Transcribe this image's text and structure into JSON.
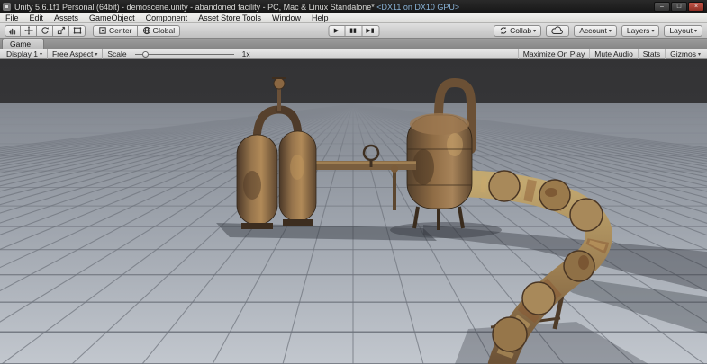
{
  "window": {
    "title_main": "Unity 5.6.1f1 Personal (64bit) - demoscene.unity - abandoned facility - PC, Mac & Linux Standalone*",
    "title_gpu": "<DX11 on DX10 GPU>",
    "minimize": "–",
    "maximize": "□",
    "close": "×"
  },
  "menu_bar": {
    "items": [
      "File",
      "Edit",
      "Assets",
      "GameObject",
      "Component",
      "Asset Store Tools",
      "Window",
      "Help"
    ]
  },
  "toolbar": {
    "pivot_label": "Center",
    "space_label": "Global",
    "play_icon": "▶",
    "pause_icon": "▮▮",
    "step_icon": "▶▮",
    "collab_label": "Collab",
    "account_label": "Account",
    "layers_label": "Layers",
    "layout_label": "Layout",
    "dropdown_arrow": "▾"
  },
  "game_panel": {
    "tab_label": "Game",
    "display_dropdown": "Display 1",
    "aspect_dropdown": "Free Aspect",
    "scale_label": "Scale",
    "scale_value": "1x",
    "maximize_on_play": "Maximize On Play",
    "mute_audio": "Mute Audio",
    "stats": "Stats",
    "gizmos": "Gizmos"
  },
  "scene": {
    "colors": {
      "sky": "#3a3a3c",
      "floor_near": "#c2c7ce",
      "floor_far": "#82878f",
      "grid_line": "#6e737c",
      "rust_dark": "#54402c",
      "rust_mid": "#8f6c45",
      "rust_light": "#c2a870",
      "shadow": "#2c3038"
    }
  }
}
